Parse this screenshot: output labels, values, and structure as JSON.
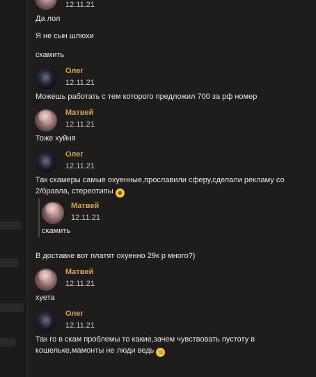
{
  "messages": [
    {
      "time": "12.11.21"
    },
    {
      "text": "Да лол"
    },
    {
      "text": "Я не сын шлюхи"
    },
    {
      "text": "скамить"
    },
    {
      "author": "Олег",
      "time": "12.11.21",
      "text": "Можешь работать с тем которого предложил 700 за рф номер"
    },
    {
      "author": "Матвей",
      "time": "12.11.21",
      "text": "Тоже хуйня"
    },
    {
      "author": "Олег",
      "time": "12.11.21",
      "text_line1": "Так скамеры самые охуенные,прославили сферу,сделали рекламу со",
      "text_line2": "2/бравла, стереотипы"
    },
    {
      "author": "Матвей",
      "time": "12.11.21",
      "text": "скамить"
    },
    {
      "text": "В доставке вот платят охуенно 29к р много?)"
    },
    {
      "author": "Матвей",
      "time": "12.11.21",
      "text": "хуета"
    },
    {
      "author": "Олег",
      "time": "12.11.21",
      "text_line1": "Так го в скам проблемы то какие,зачем чувствовать пустоту в",
      "text_line2": "кошельке,мамонты не люди ведь"
    }
  ],
  "emoji": {
    "grin": "😀",
    "wink": "😉"
  },
  "colors": {
    "author": "#d7a255",
    "background": "#1c1b1a"
  }
}
